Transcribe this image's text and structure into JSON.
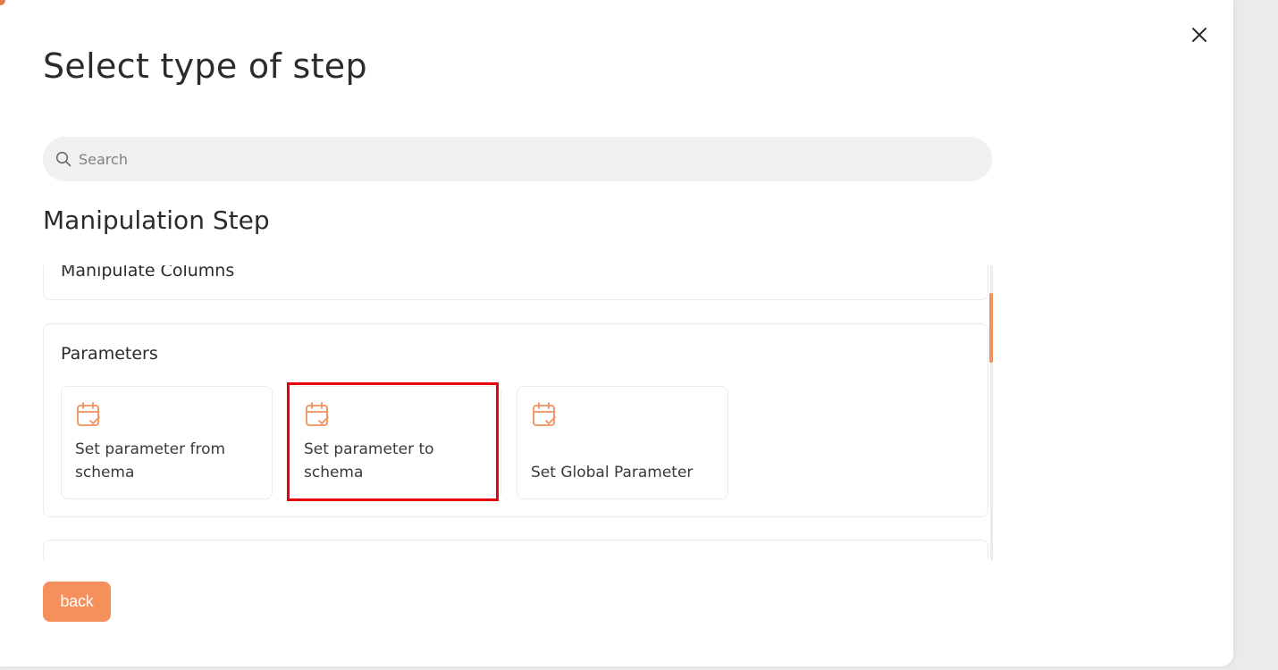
{
  "modal": {
    "title": "Select type of step",
    "close_icon": "close-icon"
  },
  "search": {
    "placeholder": "Search",
    "value": "",
    "icon": "search-icon"
  },
  "section": {
    "title": "Manipulation Step"
  },
  "groups": [
    {
      "title": "Manipulate Columns"
    },
    {
      "title": "Parameters",
      "items": [
        {
          "label": "Set parameter from schema",
          "icon": "calendar-check-icon"
        },
        {
          "label": "Set parameter to schema",
          "icon": "calendar-check-icon",
          "highlighted": true
        },
        {
          "label": "Set Global Parameter",
          "icon": "calendar-check-icon"
        }
      ]
    },
    {
      "title": ""
    }
  ],
  "footer": {
    "back_label": "back"
  },
  "colors": {
    "accent": "#f58f5c",
    "icon": "#f0915e",
    "highlight": "#e8000b",
    "search_bg": "#f0f0f0"
  }
}
